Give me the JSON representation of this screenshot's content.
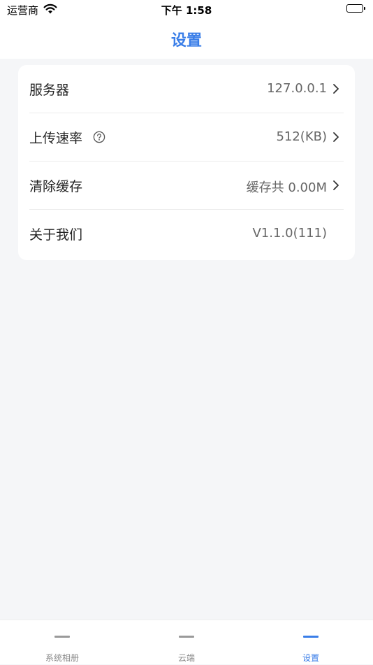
{
  "status_bar": {
    "carrier": "运营商",
    "time": "下午 1:58",
    "wifi_icon": "wifi-icon",
    "battery_icon": "battery-icon"
  },
  "header": {
    "title": "设置"
  },
  "settings": {
    "rows": [
      {
        "label": "服务器",
        "value": "127.0.0.1",
        "chevron": true
      },
      {
        "label": "上传速率",
        "value": "512(KB)",
        "chevron": true,
        "help_icon": "help-circle-icon"
      },
      {
        "label": "清除缓存",
        "value": "缓存共 0.00M",
        "chevron": true
      },
      {
        "label": "关于我们",
        "value": "V1.1.0(111)",
        "chevron": false
      }
    ]
  },
  "tabbar": {
    "tabs": [
      {
        "label": "系统相册",
        "active": false
      },
      {
        "label": "云端",
        "active": false
      },
      {
        "label": "设置",
        "active": true
      }
    ]
  },
  "colors": {
    "accent": "#3a7ee8",
    "background": "#f5f6f8"
  }
}
